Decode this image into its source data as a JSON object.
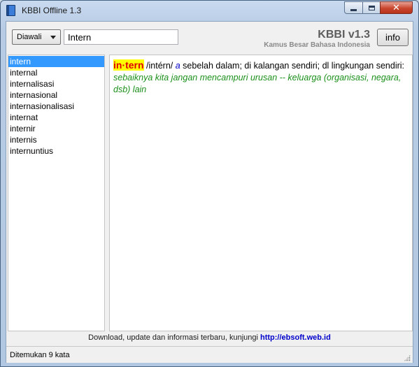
{
  "window": {
    "title": "KBBI Offline 1.3"
  },
  "toolbar": {
    "mode_selected": "Diawali",
    "search_value": "Intern",
    "brand_title": "KBBI v1.3",
    "brand_subtitle": "Kamus Besar Bahasa Indonesia",
    "info_label": "info"
  },
  "word_list": {
    "selected_index": 0,
    "items": [
      "intern",
      "internal",
      "internalisasi",
      "internasional",
      "internasionalisasi",
      "internat",
      "internir",
      "internis",
      "internuntius"
    ]
  },
  "definition": {
    "headword": "in·tern",
    "pronunciation": " /intérn/ ",
    "word_class": "a",
    "meaning": " sebelah dalam; di kalangan sendiri; dl lingkungan sendiri: ",
    "example": "sebaiknya kita jangan mencampuri urusan -- keluarga (organisasi, negara, dsb) lain"
  },
  "footer": {
    "text": "Download, update dan informasi terbaru, kunjungi ",
    "link": "http://ebsoft.web.id"
  },
  "status": {
    "text": "Ditemukan 9 kata"
  },
  "icons": {
    "app": "book-icon",
    "minimize": "minimize-icon",
    "maximize": "maximize-icon",
    "close": "close-icon",
    "dropdown": "chevron-down-icon"
  }
}
